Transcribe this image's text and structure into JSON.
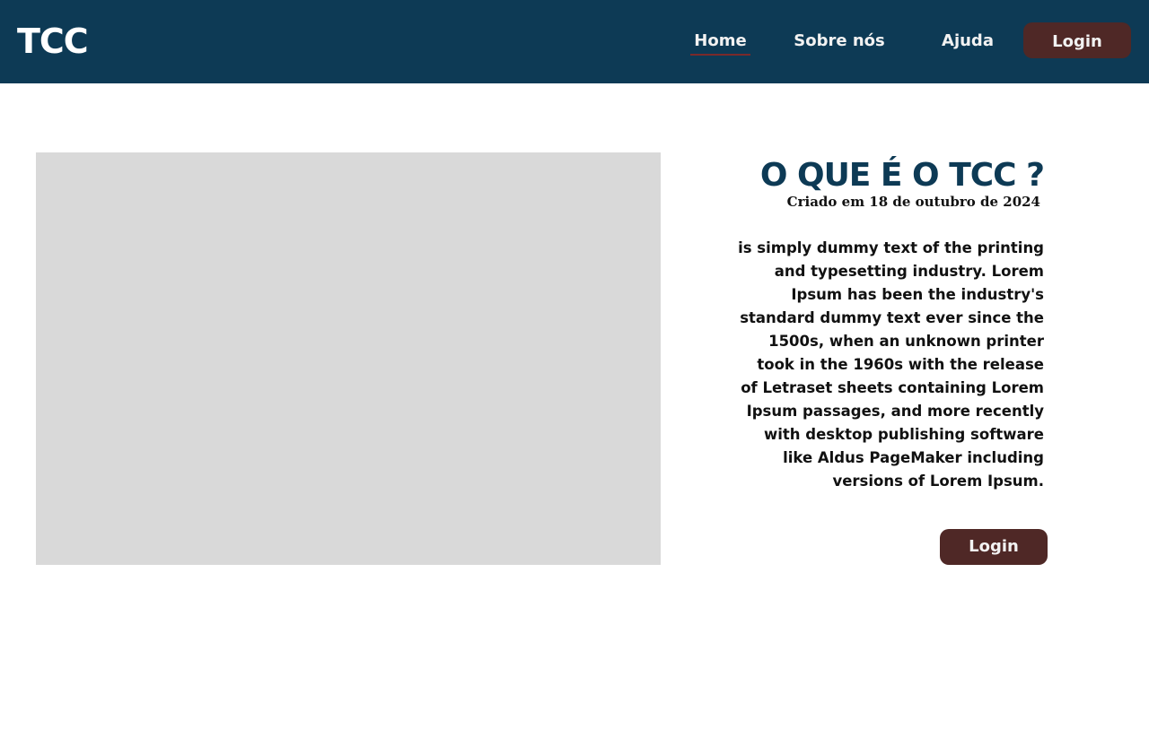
{
  "header": {
    "logo": "TCC",
    "nav": {
      "home": "Home",
      "about": "Sobre nós",
      "help": "Ajuda"
    },
    "login_label": "Login"
  },
  "main": {
    "title": "O QUE  É  O TCC ?",
    "subtitle": "Criado em 18 de outubro de 2024",
    "body": "is simply dummy text of the printing and typesetting industry. Lorem Ipsum has been the industry's standard dummy text ever since the 1500s, when an unknown printer took  in the 1960s with the release of Letraset sheets containing Lorem Ipsum passages, and more recently with desktop publishing software like Aldus PageMaker including versions of Lorem Ipsum.",
    "login_label": "Login"
  },
  "colors": {
    "header_bg": "#0d3a55",
    "button_bg": "#4f2826",
    "image_placeholder": "#d9d9d9",
    "nav_active_underline": "#7a2a2a"
  }
}
